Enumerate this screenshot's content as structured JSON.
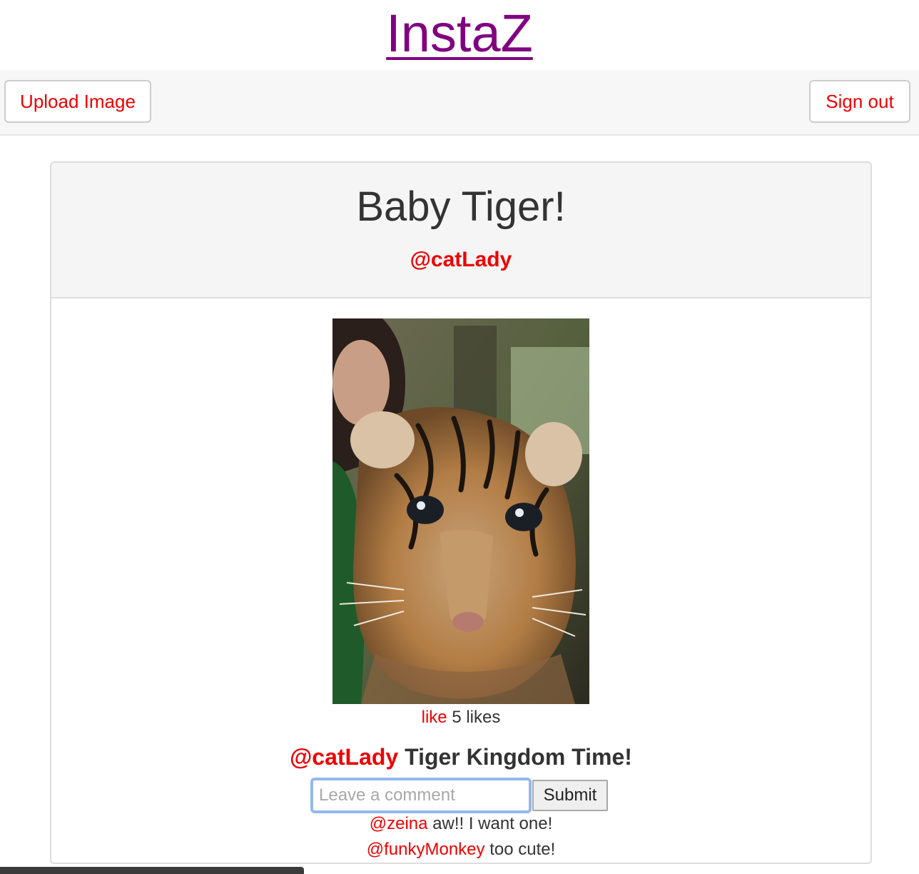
{
  "header": {
    "site_title": "InstaZ"
  },
  "navbar": {
    "upload_label": "Upload Image",
    "signout_label": "Sign out"
  },
  "post": {
    "title": "Baby Tiger!",
    "author": "@catLady",
    "image_alt": "baby tiger photo",
    "like_label": "like",
    "likes_count_text": "5 likes",
    "caption_user": "@catLady",
    "caption_text": "Tiger Kingdom Time!",
    "comment_placeholder": "Leave a comment",
    "submit_label": "Submit",
    "comments": [
      {
        "user": "@zeina",
        "text": "aw!! I want one!"
      },
      {
        "user": "@funkyMonkey",
        "text": "too cute!"
      }
    ]
  },
  "colors": {
    "accent": "#ee0000",
    "title_link": "#800080",
    "panel_heading_bg": "#f5f5f5",
    "navbar_bg": "#f7f7f7"
  }
}
